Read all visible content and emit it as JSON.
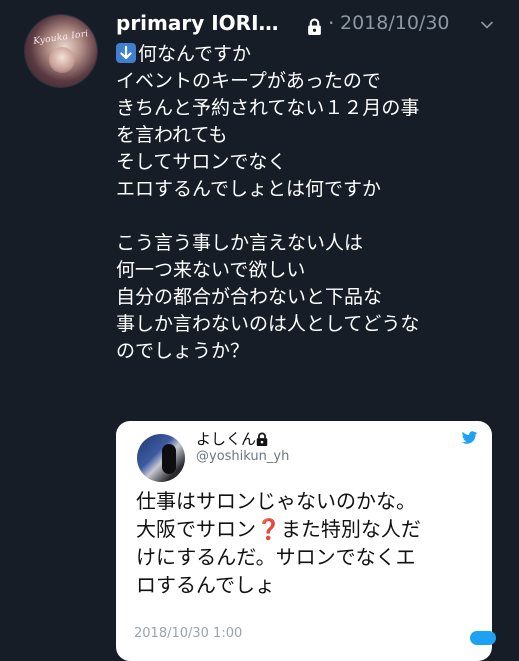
{
  "tweet": {
    "author_name": "primary IORI…",
    "separator": "·",
    "date": "2018/10/30",
    "lock_icon": "lock-icon",
    "menu_icon": "chevron-down-icon",
    "emoji_icon": "down-arrow-icon",
    "lines": [
      "何なんですか",
      "イベントのキープがあったので",
      "きちんと予約されてない１２月の事",
      "を言われても",
      "そしてサロンでなく",
      "エロするんでしょとは何ですか",
      "",
      "こう言う事しか言えない人は",
      "何一つ来ないで欲しい",
      "自分の都合が合わないと下品な",
      "事しか言わないのは人としてどうな",
      "のでしょうか？"
    ]
  },
  "quoted": {
    "name": "よしくん",
    "handle": "@yoshikun_yh",
    "lock_icon": "lock-icon",
    "brand_icon": "twitter-bird-icon",
    "line1": "仕事はサロンじゃないのかな。",
    "line2_a": "大阪でサロン",
    "line2_emoji": "❓",
    "line2_b": "また特別な人だ",
    "line3": "けにするんだ。サロンでなくエ",
    "line4": "ロするんでしょ",
    "footer": "2018/10/30 1:00"
  },
  "colors": {
    "background": "#161d27",
    "muted": "#8b98a5",
    "accent": "#1da1f2"
  }
}
